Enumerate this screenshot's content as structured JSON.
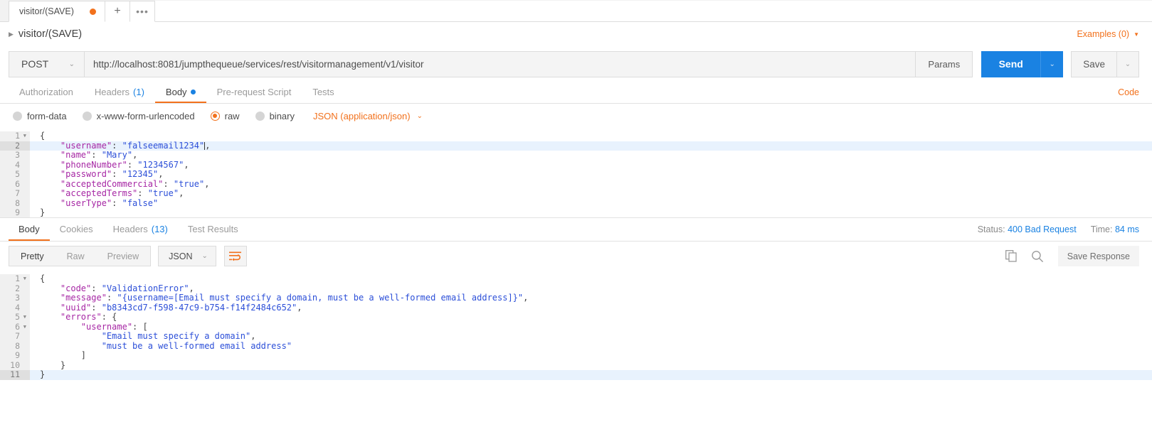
{
  "tabstrip": {
    "tab_label": "visitor/(SAVE)",
    "unsaved_dot": "unsaved",
    "new_tab_label": "+",
    "more_label": "•••"
  },
  "request": {
    "title": "visitor/(SAVE)",
    "caret": "▶",
    "examples_label": "Examples (0)",
    "method": "POST",
    "url": "http://localhost:8081/jumpthequeue/services/rest/visitormanagement/v1/visitor",
    "params_label": "Params",
    "send_label": "Send",
    "save_label": "Save",
    "tabs": [
      {
        "label": "Authorization",
        "count": "",
        "active": false
      },
      {
        "label": "Headers",
        "count": "(1)",
        "active": false
      },
      {
        "label": "Body",
        "count": "",
        "active": true
      },
      {
        "label": "Pre-request Script",
        "count": "",
        "active": false
      },
      {
        "label": "Tests",
        "count": "",
        "active": false
      }
    ],
    "code_link": "Code",
    "body_types": [
      {
        "label": "form-data",
        "selected": false
      },
      {
        "label": "x-www-form-urlencoded",
        "selected": false
      },
      {
        "label": "raw",
        "selected": true
      },
      {
        "label": "binary",
        "selected": false
      }
    ],
    "content_type": "JSON (application/json)",
    "body_lines": [
      {
        "n": "1",
        "fold": true,
        "hl": false,
        "indent": 0,
        "segments": [
          {
            "t": "{",
            "c": "p"
          }
        ]
      },
      {
        "n": "2",
        "fold": false,
        "hl": true,
        "indent": 1,
        "segments": [
          {
            "t": "\"username\"",
            "c": "k"
          },
          {
            "t": ": ",
            "c": "p"
          },
          {
            "t": "\"falseemail1234\"",
            "c": "s"
          },
          {
            "t": ",",
            "c": "p"
          }
        ]
      },
      {
        "n": "3",
        "fold": false,
        "hl": false,
        "indent": 1,
        "segments": [
          {
            "t": "\"name\"",
            "c": "k"
          },
          {
            "t": ": ",
            "c": "p"
          },
          {
            "t": "\"Mary\"",
            "c": "s"
          },
          {
            "t": ",",
            "c": "p"
          }
        ]
      },
      {
        "n": "4",
        "fold": false,
        "hl": false,
        "indent": 1,
        "segments": [
          {
            "t": "\"phoneNumber\"",
            "c": "k"
          },
          {
            "t": ": ",
            "c": "p"
          },
          {
            "t": "\"1234567\"",
            "c": "s"
          },
          {
            "t": ",",
            "c": "p"
          }
        ]
      },
      {
        "n": "5",
        "fold": false,
        "hl": false,
        "indent": 1,
        "segments": [
          {
            "t": "\"password\"",
            "c": "k"
          },
          {
            "t": ": ",
            "c": "p"
          },
          {
            "t": "\"12345\"",
            "c": "s"
          },
          {
            "t": ",",
            "c": "p"
          }
        ]
      },
      {
        "n": "6",
        "fold": false,
        "hl": false,
        "indent": 1,
        "segments": [
          {
            "t": "\"acceptedCommercial\"",
            "c": "k"
          },
          {
            "t": ": ",
            "c": "p"
          },
          {
            "t": "\"true\"",
            "c": "s"
          },
          {
            "t": ",",
            "c": "p"
          }
        ]
      },
      {
        "n": "7",
        "fold": false,
        "hl": false,
        "indent": 1,
        "segments": [
          {
            "t": "\"acceptedTerms\"",
            "c": "k"
          },
          {
            "t": ": ",
            "c": "p"
          },
          {
            "t": "\"true\"",
            "c": "s"
          },
          {
            "t": ",",
            "c": "p"
          }
        ]
      },
      {
        "n": "8",
        "fold": false,
        "hl": false,
        "indent": 1,
        "segments": [
          {
            "t": "\"userType\"",
            "c": "k"
          },
          {
            "t": ": ",
            "c": "p"
          },
          {
            "t": "\"false\"",
            "c": "s"
          }
        ]
      },
      {
        "n": "9",
        "fold": false,
        "hl": false,
        "indent": 0,
        "segments": [
          {
            "t": "}",
            "c": "p"
          }
        ]
      }
    ]
  },
  "response": {
    "tabs": [
      {
        "label": "Body",
        "count": "",
        "active": true
      },
      {
        "label": "Cookies",
        "count": "",
        "active": false
      },
      {
        "label": "Headers",
        "count": "(13)",
        "active": false
      },
      {
        "label": "Test Results",
        "count": "",
        "active": false
      }
    ],
    "status_label": "Status:",
    "status_value": "400 Bad Request",
    "time_label": "Time:",
    "time_value": "84 ms",
    "view_modes": [
      {
        "label": "Pretty",
        "active": true
      },
      {
        "label": "Raw",
        "active": false
      },
      {
        "label": "Preview",
        "active": false
      }
    ],
    "format": "JSON",
    "save_response_label": "Save Response",
    "body_lines": [
      {
        "n": "1",
        "fold": true,
        "hl": false,
        "indent": 0,
        "segments": [
          {
            "t": "{",
            "c": "p"
          }
        ]
      },
      {
        "n": "2",
        "fold": false,
        "hl": false,
        "indent": 1,
        "segments": [
          {
            "t": "\"code\"",
            "c": "k"
          },
          {
            "t": ": ",
            "c": "p"
          },
          {
            "t": "\"ValidationError\"",
            "c": "s"
          },
          {
            "t": ",",
            "c": "p"
          }
        ]
      },
      {
        "n": "3",
        "fold": false,
        "hl": false,
        "indent": 1,
        "segments": [
          {
            "t": "\"message\"",
            "c": "k"
          },
          {
            "t": ": ",
            "c": "p"
          },
          {
            "t": "\"{username=[Email must specify a domain, must be a well-formed email address]}\"",
            "c": "s"
          },
          {
            "t": ",",
            "c": "p"
          }
        ]
      },
      {
        "n": "4",
        "fold": false,
        "hl": false,
        "indent": 1,
        "segments": [
          {
            "t": "\"uuid\"",
            "c": "k"
          },
          {
            "t": ": ",
            "c": "p"
          },
          {
            "t": "\"b8343cd7-f598-47c9-b754-f14f2484c652\"",
            "c": "s"
          },
          {
            "t": ",",
            "c": "p"
          }
        ]
      },
      {
        "n": "5",
        "fold": true,
        "hl": false,
        "indent": 1,
        "segments": [
          {
            "t": "\"errors\"",
            "c": "k"
          },
          {
            "t": ": {",
            "c": "p"
          }
        ]
      },
      {
        "n": "6",
        "fold": true,
        "hl": false,
        "indent": 2,
        "segments": [
          {
            "t": "\"username\"",
            "c": "k"
          },
          {
            "t": ": [",
            "c": "p"
          }
        ]
      },
      {
        "n": "7",
        "fold": false,
        "hl": false,
        "indent": 3,
        "segments": [
          {
            "t": "\"Email must specify a domain\"",
            "c": "s"
          },
          {
            "t": ",",
            "c": "p"
          }
        ]
      },
      {
        "n": "8",
        "fold": false,
        "hl": false,
        "indent": 3,
        "segments": [
          {
            "t": "\"must be a well-formed email address\"",
            "c": "s"
          }
        ]
      },
      {
        "n": "9",
        "fold": false,
        "hl": false,
        "indent": 2,
        "segments": [
          {
            "t": "]",
            "c": "p"
          }
        ]
      },
      {
        "n": "10",
        "fold": false,
        "hl": false,
        "indent": 1,
        "segments": [
          {
            "t": "}",
            "c": "p"
          }
        ]
      },
      {
        "n": "11",
        "fold": false,
        "hl": true,
        "indent": 0,
        "segments": [
          {
            "t": "}",
            "c": "p"
          }
        ]
      }
    ]
  },
  "colors": {
    "accent_orange": "#f2711c",
    "accent_blue": "#1a82e2",
    "json_key": "#a626a4",
    "json_string": "#2c4fd8"
  }
}
